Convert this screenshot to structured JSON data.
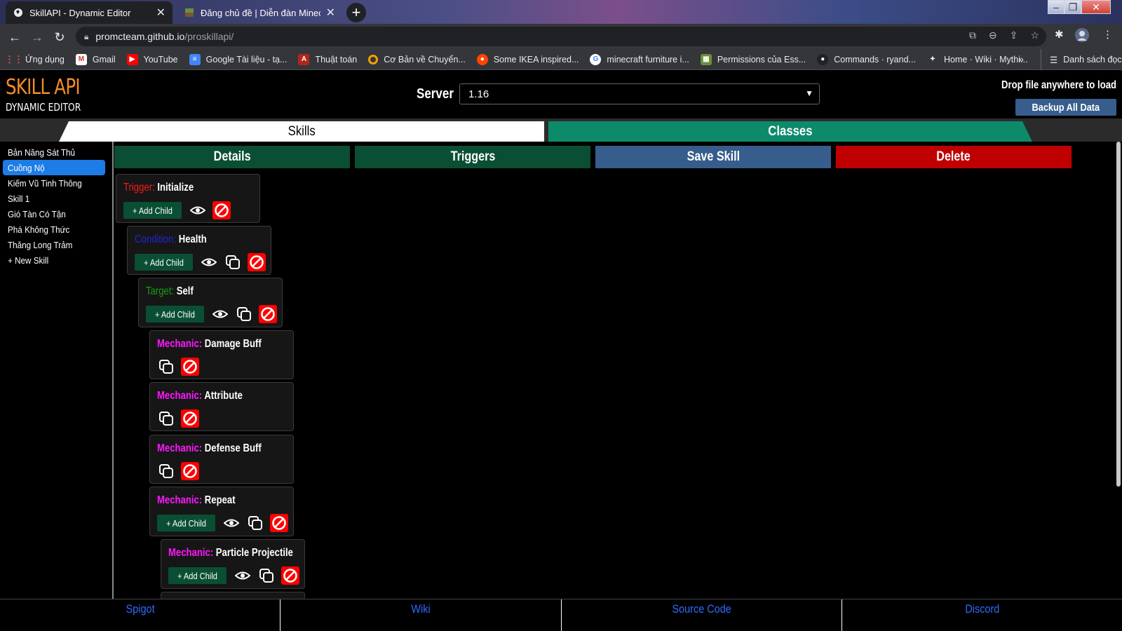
{
  "browser": {
    "tabs": [
      {
        "title": "SkillAPI - Dynamic Editor",
        "active": true
      },
      {
        "title": "Đăng chủ đề | Diễn đàn Minecraft",
        "active": false
      }
    ],
    "url_host": "promcteam.github.io",
    "url_path": "/proskillapi/",
    "bookmarks": [
      {
        "label": "Ứng dụng",
        "icon": "apps-grid-icon"
      },
      {
        "label": "Gmail",
        "icon": "gmail-icon"
      },
      {
        "label": "YouTube",
        "icon": "youtube-icon"
      },
      {
        "label": "Google Tài liệu - tạ...",
        "icon": "docs-icon"
      },
      {
        "label": "Thuật toán",
        "icon": "algorithm-icon"
      },
      {
        "label": "Cơ Bản về Chuyển...",
        "icon": "ring-icon"
      },
      {
        "label": "Some IKEA inspired...",
        "icon": "reddit-icon"
      },
      {
        "label": "minecraft furniture i...",
        "icon": "google-icon"
      },
      {
        "label": "Permissions của Ess...",
        "icon": "minecraft-icon"
      },
      {
        "label": "Commands · ryand...",
        "icon": "github-icon"
      },
      {
        "label": "Home · Wiki · Mythi...",
        "icon": "mythic-icon"
      }
    ],
    "reading_list": "Danh sách đọc"
  },
  "header": {
    "logo_line1": "SKILL API",
    "logo_line2": "DYNAMIC EDITOR",
    "server_label": "Server",
    "server_value": "1.16",
    "drop_text": "Drop file anywhere to load",
    "backup_label": "Backup All Data"
  },
  "main_tabs": {
    "skills": "Skills",
    "classes": "Classes"
  },
  "sidebar": {
    "items": [
      {
        "label": "Bản Năng Sát Thủ",
        "active": false
      },
      {
        "label": "Cuồng Nộ",
        "active": true
      },
      {
        "label": "Kiếm Vũ Tinh Thông",
        "active": false
      },
      {
        "label": "Skill 1",
        "active": false
      },
      {
        "label": "Gió Tàn Có Tận",
        "active": false
      },
      {
        "label": "Phá Không Thức",
        "active": false
      },
      {
        "label": "Thăng Long Trảm",
        "active": false
      }
    ],
    "new_skill": "+ New Skill"
  },
  "actions": {
    "details": "Details",
    "triggers": "Triggers",
    "save": "Save Skill",
    "delete": "Delete"
  },
  "components": [
    {
      "kind": "Trigger:",
      "kind_class": "k-trigger",
      "name": "Initialize",
      "add_child": true,
      "view": true,
      "copy": false
    },
    {
      "kind": "Condition:",
      "kind_class": "k-condition",
      "name": "Health",
      "add_child": true,
      "view": true,
      "copy": true
    },
    {
      "kind": "Target:",
      "kind_class": "k-target",
      "name": "Self",
      "add_child": true,
      "view": true,
      "copy": true
    },
    {
      "kind": "Mechanic:",
      "kind_class": "k-mechanic",
      "name": "Damage Buff",
      "add_child": false,
      "view": false,
      "copy": true
    },
    {
      "kind": "Mechanic:",
      "kind_class": "k-mechanic",
      "name": "Attribute",
      "add_child": false,
      "view": false,
      "copy": true
    },
    {
      "kind": "Mechanic:",
      "kind_class": "k-mechanic",
      "name": "Defense Buff",
      "add_child": false,
      "view": false,
      "copy": true
    },
    {
      "kind": "Mechanic:",
      "kind_class": "k-mechanic",
      "name": "Repeat",
      "add_child": true,
      "view": true,
      "copy": true
    },
    {
      "kind": "Mechanic:",
      "kind_class": "k-mechanic",
      "name": "Particle Projectile",
      "add_child": true,
      "view": true,
      "copy": true
    }
  ],
  "add_child_label": "+ Add Child",
  "footer": {
    "spigot": "Spigot",
    "wiki": "Wiki",
    "source": "Source Code",
    "discord": "Discord"
  }
}
